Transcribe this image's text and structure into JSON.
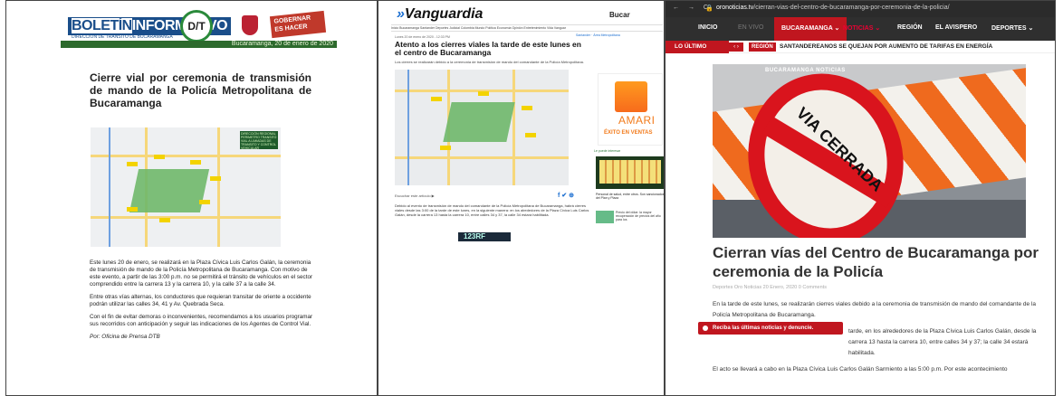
{
  "panel1": {
    "logo_left": "BOLETÍN",
    "logo_right": "INFORMATIVO",
    "logo_sub": "DIRECCIÓN DE TRÁNSITO DE BUCARAMANGA",
    "dt": "D/T",
    "gov_text": "GOBERNAR ES HACER",
    "date": "Bucaramanga, 20 de enero de 2020",
    "title": "Cierre vial por ceremonia de transmisión de mando de la Policía Metropolitana de Bucaramanga",
    "map_legend": "DIRECCIÓN REGIONAL PERIMETRO TRANSITO VIAL A LIMIADAS DE TRANSITO Y CONTROL VEHICULAR",
    "paragraphs": [
      "Este lunes 20 de enero, se realizará en la Plaza Cívica Luis Carlos Galán, la ceremonia de transmisión de mando de la Policía Metropolitana de Bucaramanga. Con motivo de este evento, a partir de las 3:00 p.m. no se permitirá el tránsito de vehículos en el sector comprendido entre la carrera 13 y la carrera 10, y la calle 37 a la calle 34.",
      "Entre otras vías alternas, los conductores que requieran transitar de oriente a occidente podrán utilizar las calles 34, 41 y Av. Quebrada Seca.",
      "Con el fin de evitar demoras o inconvenientes, recomendamos a los usuarios programar sus recorridos con anticipación y seguir las indicaciones de los Agentes de Control Vial."
    ],
    "signature": "Por: Oficina de Prensa DTB"
  },
  "panel2": {
    "logo": "Vanguardia",
    "region": "Bucar",
    "nav": "Inicio   Bucaramanga   Santander   Deportes   Judicial   Colombia   Mundo   Política   Economía   Opinión   Entretenimiento   Vida   Vanguar",
    "meta": "Lunes 20 de enero de 2020 - 12:33 PM",
    "meta_right": "Santander · Área Metropolitana",
    "title": "Atento a los cierres viales la tarde de este lunes en el centro de Bucaramanga",
    "lead": "Los cierres se realizarán debido a la ceremonia de transmisión de mando del comandante de la Policía Metropolitana.",
    "ad_brand": "AMARI",
    "ad_cta": "ÉXITO EN VENTAS",
    "side_head": "Le puede interesar",
    "side_item1": "Personal de salud, entre otros. Son sancionados del Plan y Plaza",
    "side_item2": "Precio del dólar: la mayor recuperación de precios del año para los",
    "listen": "Escuchar este artículo ▶",
    "share": "f ✔ ⊕",
    "body": "Debido al evento de transmisión de mando del comandante de la Policía Metropolitana de Bucaramanga, habrá cierres viales desde las 3:00 de la tarde de este lunes, en la siguiente manera: en los alrededores de la Plaza Cívica Luis Carlos Galán, desde la carrera 13 hasta la carrera 10, entre calles 34 y 37, la calle 34 estará habilitada.",
    "banner": "123RF"
  },
  "panel3": {
    "url_domain": "oronoticias.tv",
    "url_path": "/cierran-vias-del-centro-de-bucaramanga-por-ceremonia-de-la-policia/",
    "nav": [
      "INICIO",
      "EN VIVO",
      "BUCARAMANGA ⌄",
      "NOTICIAS ⌄",
      "REGIÓN",
      "EL AVISPERO",
      "DEPORTES ⌄"
    ],
    "lo_ultimo": "LO ÚLTIMO",
    "arrows": "‹ ›",
    "region_tag": "REGIÓN",
    "headline_ticker": "SANTANDEREANOS SE QUEJAN POR AUMENTO DE TARIFAS EN ENERGÍA",
    "hero_cats": "BUCARAMANGA   NOTICIAS",
    "sign_text": "VIA CERRADA",
    "title": "Cierran vías del Centro de Bucaramanga por ceremonia de la Policía",
    "meta": "Deportes Oro Noticias   20 Enero, 2020   0 Comments",
    "p1": "En la tarde de este lunes, se realizarán cierres viales debido a la ceremonia de transmisión de mando del comandante de la Policía Metropolitana de Bucaramanga.",
    "p2": "tarde, en los alrededores de la Plaza Cívica Luis Carlos Galán, desde la carrera 13 hasta la carrera 10, entre calles 34 y 37; la calle 34 estará habilitada.",
    "p3": "El acto se llevará a cabo en la Plaza Cívica Luis Carlos Galán Sarmiento a las 5:00 p.m. Por este acontecimiento",
    "toast": "Reciba las últimas noticias y denuncie."
  }
}
